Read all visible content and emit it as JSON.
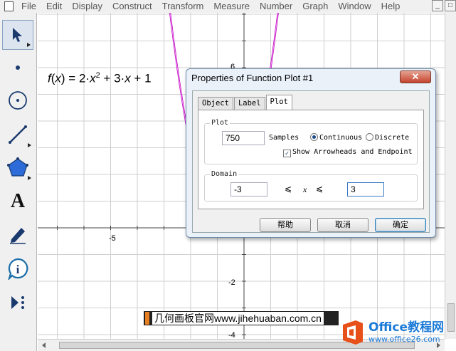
{
  "menubar": {
    "items": [
      "File",
      "Edit",
      "Display",
      "Construct",
      "Transform",
      "Measure",
      "Number",
      "Graph",
      "Window",
      "Help"
    ],
    "window_buttons": [
      "_",
      "□"
    ]
  },
  "toolbar": {
    "tools": [
      {
        "name": "arrow-select-tool",
        "icon": "arrow-icon"
      },
      {
        "name": "point-tool",
        "icon": "point-icon"
      },
      {
        "name": "compass-tool",
        "icon": "circle-icon"
      },
      {
        "name": "straightedge-tool",
        "icon": "segment-icon"
      },
      {
        "name": "polygon-tool",
        "icon": "polygon-icon"
      },
      {
        "name": "text-tool",
        "icon": "text-a-icon",
        "glyph": "A"
      },
      {
        "name": "marker-tool",
        "icon": "pen-icon"
      },
      {
        "name": "information-tool",
        "icon": "info-icon"
      },
      {
        "name": "custom-tool",
        "icon": "custom-tools-icon"
      }
    ]
  },
  "graph": {
    "x_tick_labels": [
      "-5"
    ],
    "y_tick_labels": [
      "6",
      "-2",
      "-4"
    ],
    "function_label": {
      "fname": "f",
      "var": "x",
      "rhs_a": "2·",
      "rhs_x": "x",
      "exp": "2",
      "rhs_b": " + 3·",
      "rhs_x2": "x",
      "rhs_c": " + 1"
    },
    "curve_color": "#c000c0"
  },
  "dialog": {
    "title": "Properties of Function Plot #1",
    "close_label": "✕",
    "tabs": [
      "Object",
      "Label",
      "Plot"
    ],
    "active_tab": "Plot",
    "plot_group_legend": "Plot",
    "samples_value": "750",
    "samples_label": "Samples",
    "continuous_label": "Continuous",
    "discrete_label": "Discrete",
    "plot_mode": "Continuous",
    "arrowheads_label": "Show Arrowheads and Endpoint",
    "arrowheads_checked": true,
    "domain_legend": "Domain",
    "domain_min": "-3",
    "domain_max": "3",
    "domain_lte_1": "⩽",
    "domain_var": "x",
    "domain_lte_2": "⩽",
    "buttons": {
      "help": "帮助",
      "cancel": "取消",
      "ok": "确定"
    }
  },
  "watermark": {
    "text": "几何画板官网www.jihehuaban.com.cn"
  },
  "brand": {
    "name": "Office教程网",
    "url": "www.office26.com"
  }
}
